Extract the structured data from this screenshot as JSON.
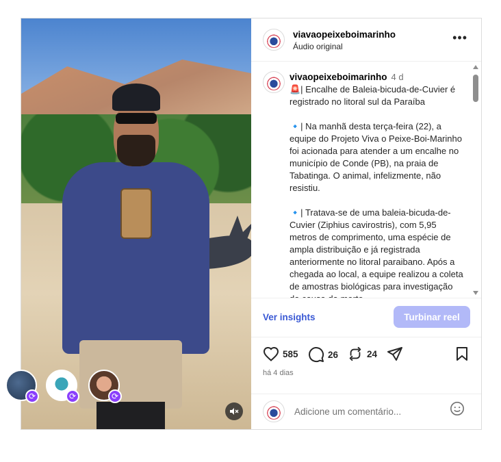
{
  "post": {
    "username": "viavaopeixeboimarinho",
    "audio_label": "Áudio original",
    "more_label": "•••"
  },
  "caption": {
    "username": "vivaopeixeboimarinho",
    "age": "4 d",
    "text": "🚨| Encalhe de Baleia-bicuda-de-Cuvier é registrado no litoral sul da Paraíba\n\n🔹| Na manhã desta terça-feira (22), a equipe do Projeto Viva o Peixe-Boi-Marinho foi acionada para atender a um encalhe no município de Conde (PB), na praia de Tabatinga. O animal, infelizmente, não resistiu.\n\n🔹| Tratava-se de uma baleia-bicuda-de-Cuvier (Ziphius cavirostris), com 5,95 metros de comprimento, uma espécie de ampla distribuição e já registrada anteriormente no litoral paraibano. Após a chegada ao local, a equipe realizou a coleta de amostras biológicas para investigação da causa da morte."
  },
  "insights": {
    "view_label": "Ver insights",
    "boost_label": "Turbinar reel"
  },
  "stats": {
    "likes": "585",
    "comments": "26",
    "reposts": "24"
  },
  "time_ago": "há 4 dias",
  "comment": {
    "placeholder": "Adicione um comentário..."
  },
  "icons": {
    "like": "heart-icon",
    "comment": "comment-icon",
    "repost": "repost-icon",
    "share": "send-icon",
    "save": "bookmark-icon",
    "emoji": "emoji-icon",
    "mute": "muted-speaker-icon",
    "collab": "repost-badge-icon"
  },
  "colors": {
    "accent": "#3958d4",
    "boost_bg": "#b2b9f8",
    "collab_badge": "#8a3ffc"
  }
}
